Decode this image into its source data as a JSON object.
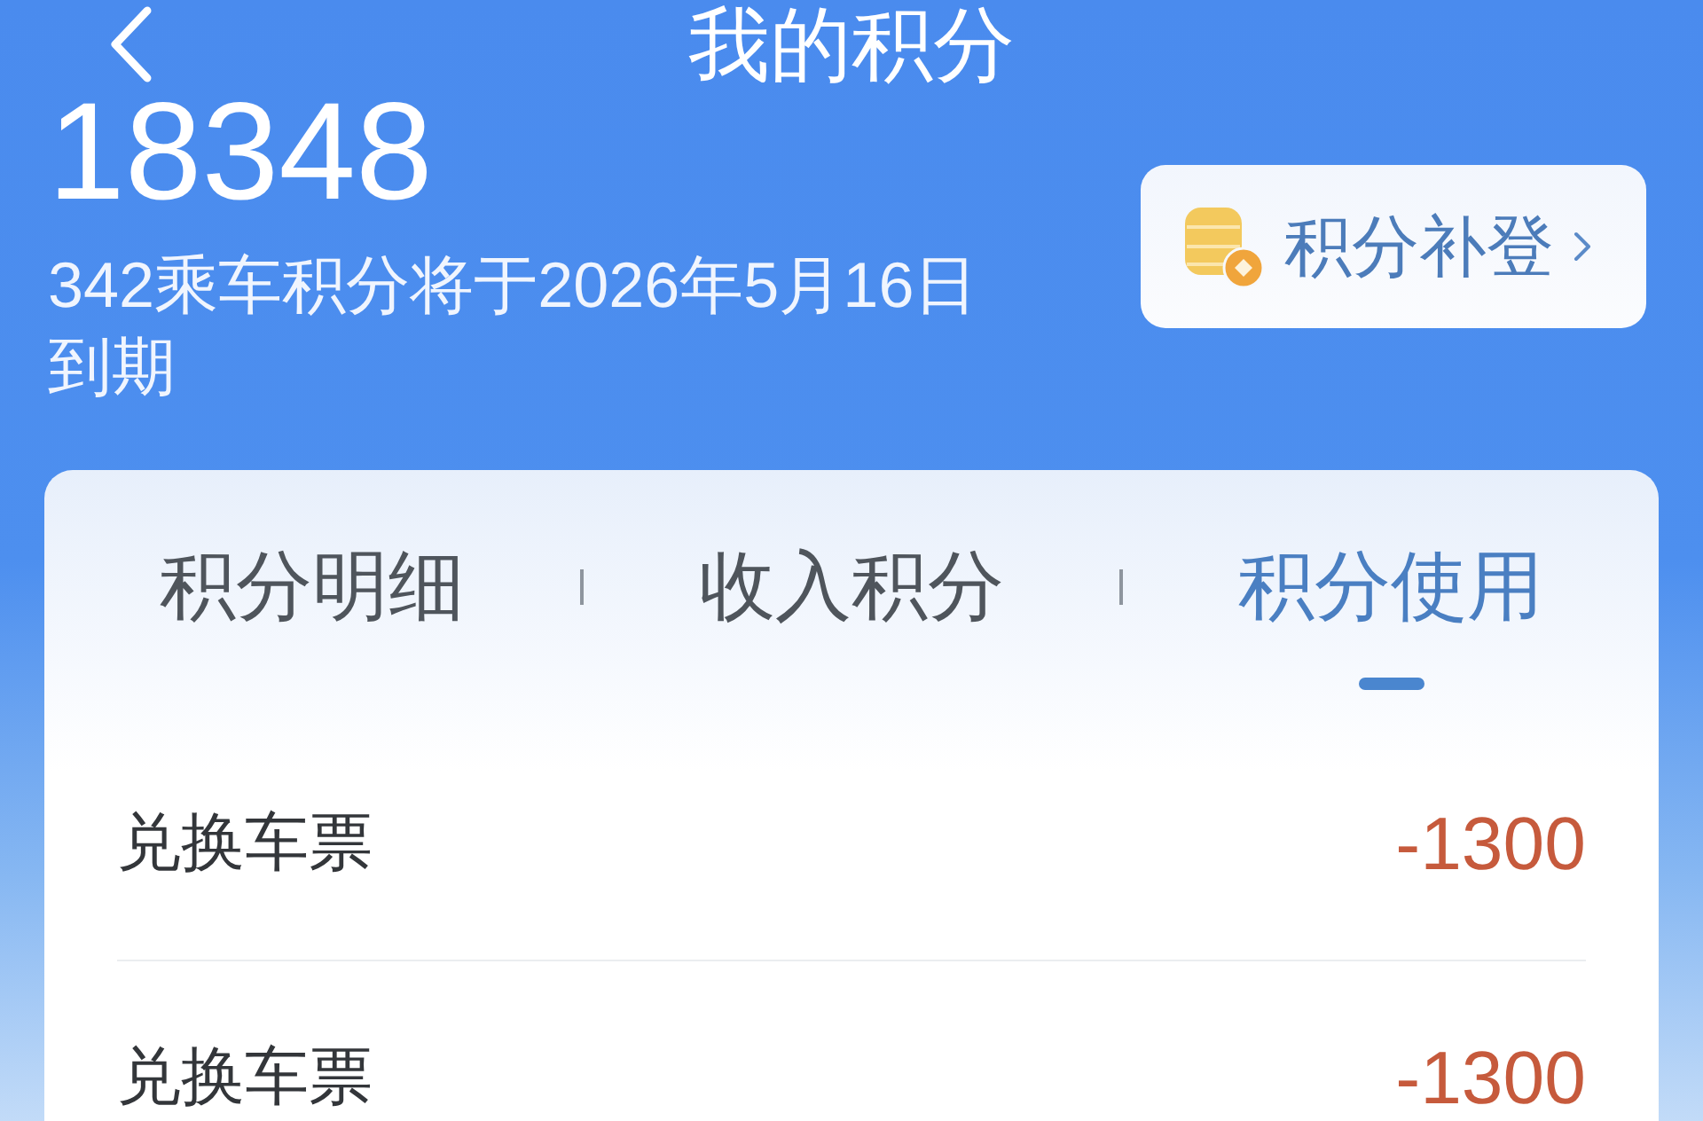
{
  "header": {
    "title": "我的积分"
  },
  "summary": {
    "points": "18348",
    "expiry_note": "342乘车积分将于2026年5月16日到期",
    "makeup_button": {
      "label": "积分补登"
    }
  },
  "tabs": [
    {
      "label": "积分明细",
      "selected": false
    },
    {
      "label": "收入积分",
      "selected": false
    },
    {
      "label": "积分使用",
      "selected": true
    }
  ],
  "records": [
    {
      "title": "兑换车票",
      "amount": "-1300"
    },
    {
      "title": "兑换车票",
      "amount": "-1300"
    }
  ]
}
